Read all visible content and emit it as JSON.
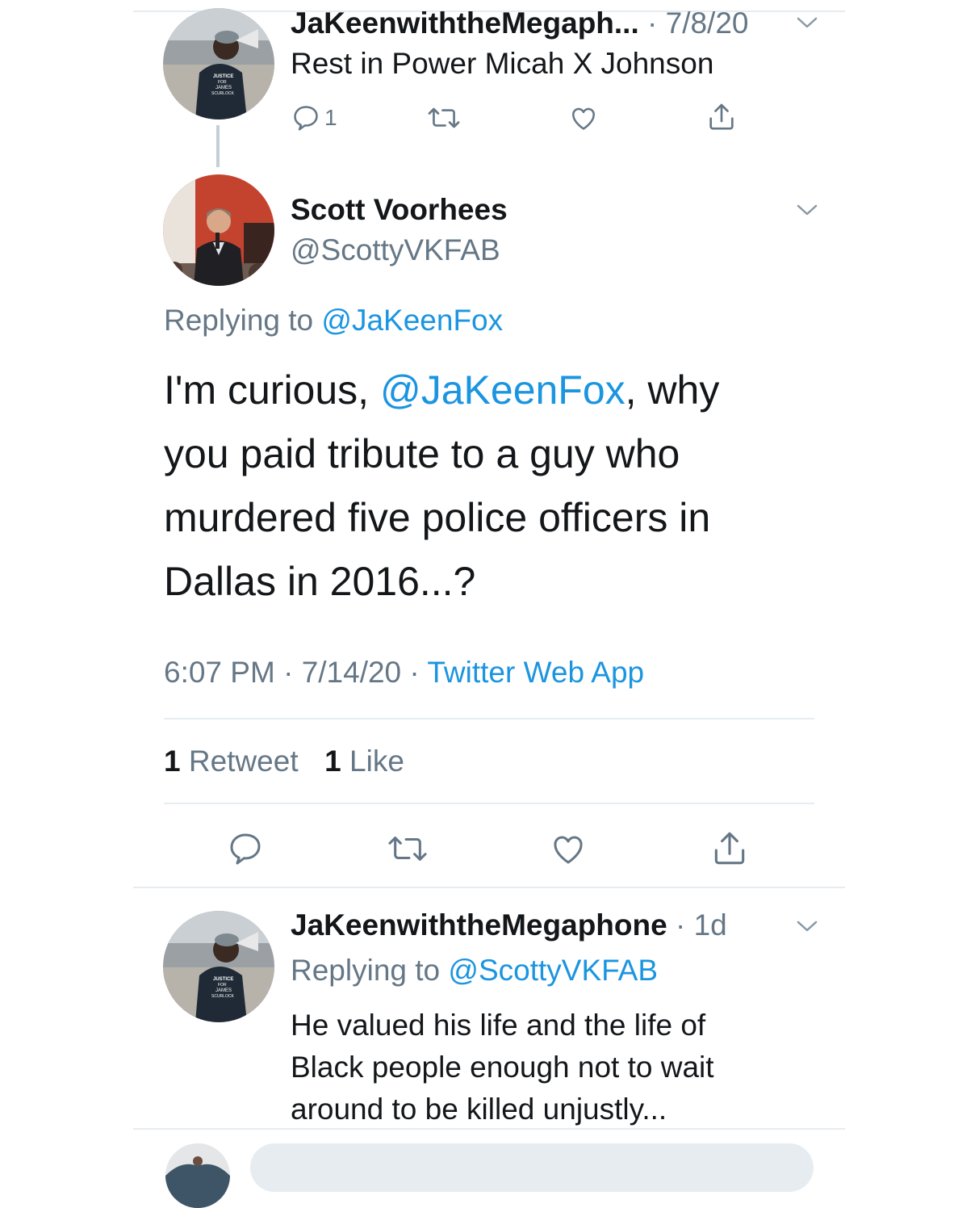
{
  "parent_tweet": {
    "name": "JaKeenwiththeMegaph...",
    "separator": "·",
    "date": "7/8/20",
    "text": "Rest in Power Micah X Johnson",
    "reply_count": "1",
    "avatar_shirt_text": "JUSTICE FOR JAMES SCURLOCK"
  },
  "main_tweet": {
    "name": "Scott Voorhees",
    "handle": "@ScottyVKFAB",
    "replying_prefix": "Replying to",
    "replying_to": "@JaKeenFox",
    "text_line1_a": "I'm curious,",
    "text_mention": "@JaKeenFox",
    "text_line1_b": ", why",
    "text_line2": "you paid tribute to a guy who",
    "text_line3": "murdered five police officers in",
    "text_line4": "Dallas in 2016...?",
    "time": "6:07 PM",
    "date": "7/14/20",
    "source": "Twitter Web App",
    "retweet_count": "1",
    "retweet_label": "Retweet",
    "like_count": "1",
    "like_label": "Like"
  },
  "reply_tweet": {
    "name": "JaKeenwiththeMegaphone",
    "separator": "·",
    "age": "1d",
    "replying_prefix": "Replying to",
    "replying_to": "@ScottyVKFAB",
    "text_line1": "He valued his life and the life of",
    "text_line2": "Black people enough not to wait",
    "text_line3": "around to be killed unjustly..."
  },
  "colors": {
    "accent": "#1b95e0",
    "muted": "#657786",
    "divider": "#e6ecf0"
  },
  "icons": [
    "reply-icon",
    "retweet-icon",
    "like-icon",
    "share-icon",
    "chevron-down-icon"
  ]
}
